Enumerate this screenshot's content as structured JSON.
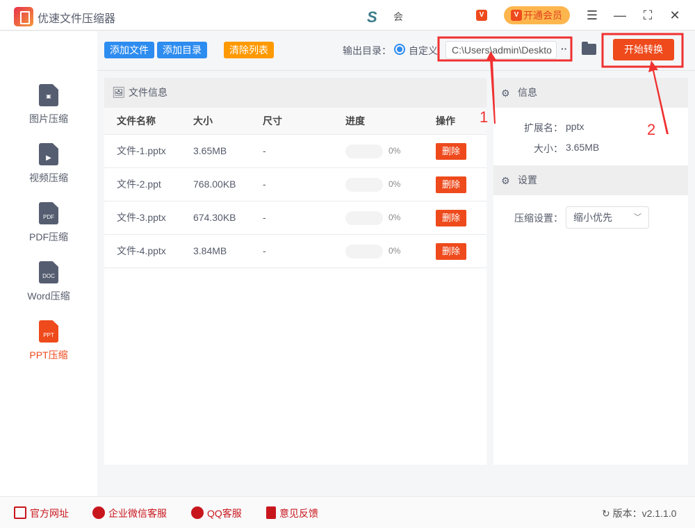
{
  "app": {
    "title": "优速文件压缩器",
    "center_text": "会",
    "vip_label": "开通会员"
  },
  "sidebar": {
    "items": [
      {
        "label": "图片压缩",
        "icon": "image-file-icon",
        "badge": ""
      },
      {
        "label": "视频压缩",
        "icon": "video-file-icon",
        "badge": "▶"
      },
      {
        "label": "PDF压缩",
        "icon": "pdf-file-icon",
        "badge": "PDF"
      },
      {
        "label": "Word压缩",
        "icon": "doc-file-icon",
        "badge": "DOC"
      },
      {
        "label": "PPT压缩",
        "icon": "ppt-file-icon",
        "badge": "PPT",
        "active": true
      }
    ]
  },
  "toolbar": {
    "add_file": "添加文件",
    "add_dir": "添加目录",
    "clear": "清除列表",
    "output_label": "输出目录：",
    "custom_label": "自定义",
    "path": "C:\\Users\\admin\\Deskto",
    "more": "··",
    "start": "开始转换"
  },
  "files": {
    "title": "文件信息",
    "columns": [
      "文件名称",
      "大小",
      "尺寸",
      "进度",
      "操作"
    ],
    "rows": [
      {
        "name": "文件-1.pptx",
        "size": "3.65MB",
        "dim": "-",
        "progress": "0%",
        "action": "删除"
      },
      {
        "name": "文件-2.ppt",
        "size": "768.00KB",
        "dim": "-",
        "progress": "0%",
        "action": "删除"
      },
      {
        "name": "文件-3.pptx",
        "size": "674.30KB",
        "dim": "-",
        "progress": "0%",
        "action": "删除"
      },
      {
        "name": "文件-4.pptx",
        "size": "3.84MB",
        "dim": "-",
        "progress": "0%",
        "action": "删除"
      }
    ]
  },
  "info": {
    "title": "信息",
    "ext_label": "扩展名：",
    "ext": "pptx",
    "size_label": "大小：",
    "size": "3.65MB"
  },
  "settings": {
    "title": "设置",
    "compress_label": "压缩设置：",
    "compress_value": "缩小优先"
  },
  "footer": {
    "website": "官方网址",
    "wechat": "企业微信客服",
    "qq": "QQ客服",
    "feedback": "意见反馈",
    "version": "版本：v2.1.1.0"
  },
  "annotations": {
    "step1": "1",
    "step2": "2",
    "color": "#f03030"
  },
  "colors": {
    "accent": "#ee4a1c",
    "blue": "#2d8cf0",
    "orange": "#ff9900"
  }
}
